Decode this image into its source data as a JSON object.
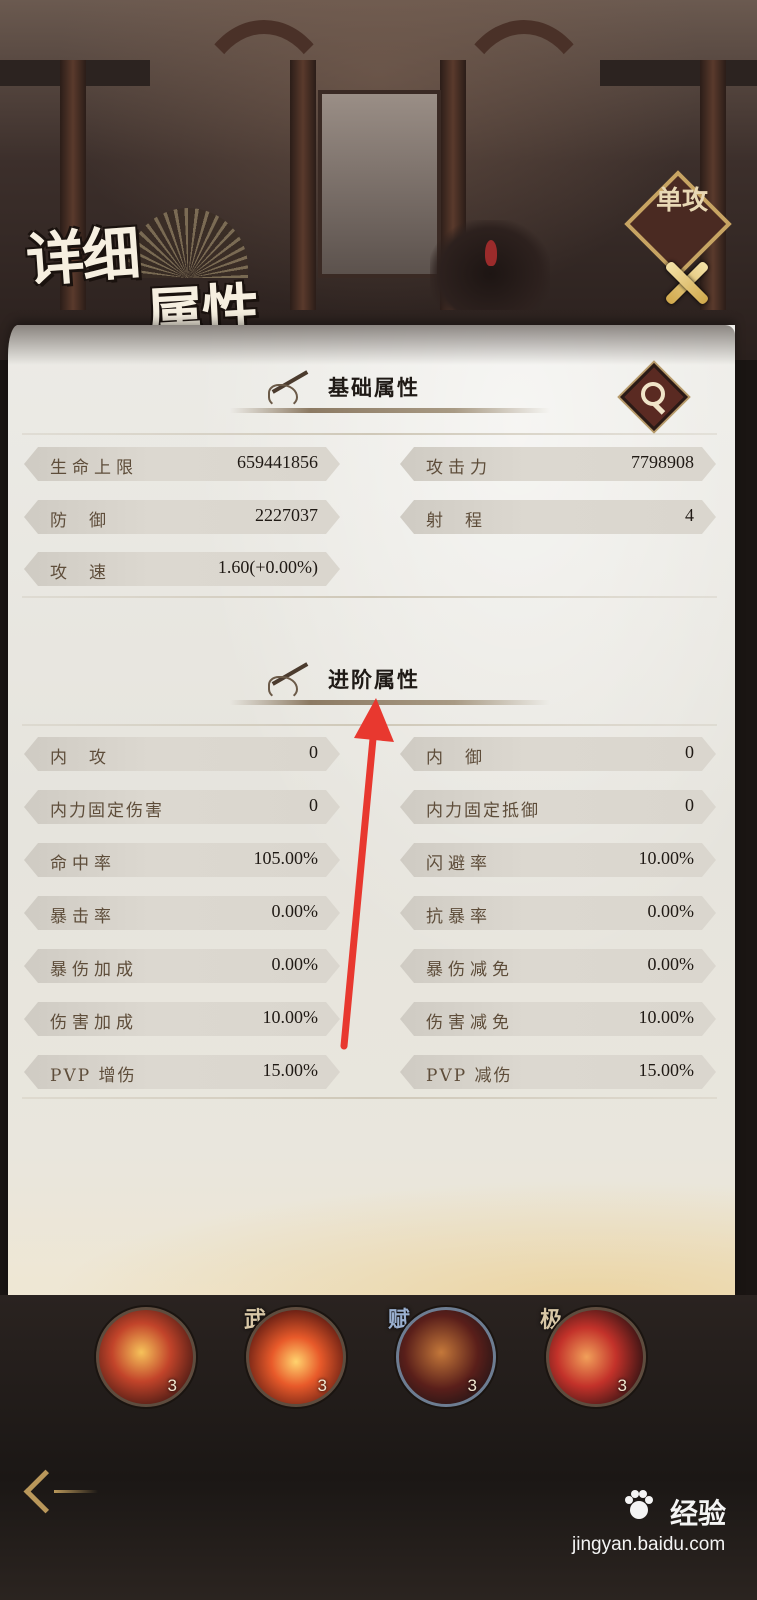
{
  "title": {
    "line1": "详细",
    "line2": "属性"
  },
  "mode_tag": "单攻",
  "sections": {
    "basic": {
      "title": "基础属性"
    },
    "advanced": {
      "title": "进阶属性"
    }
  },
  "basic_stats": [
    {
      "label": "生命上限",
      "value": "659441856"
    },
    {
      "label": "攻击力",
      "value": "7798908"
    },
    {
      "label": "防御",
      "value": "2227037"
    },
    {
      "label": "射程",
      "value": "4"
    },
    {
      "label": "攻速",
      "value": "1.60(+0.00%)"
    }
  ],
  "advanced_stats": [
    {
      "label": "内攻",
      "value": "0"
    },
    {
      "label": "内御",
      "value": "0"
    },
    {
      "label": "内力固定伤害",
      "value": "0"
    },
    {
      "label": "内力固定抵御",
      "value": "0"
    },
    {
      "label": "命中率",
      "value": "105.00%"
    },
    {
      "label": "闪避率",
      "value": "10.00%"
    },
    {
      "label": "暴击率",
      "value": "0.00%"
    },
    {
      "label": "抗暴率",
      "value": "0.00%"
    },
    {
      "label": "暴伤加成",
      "value": "0.00%"
    },
    {
      "label": "暴伤减免",
      "value": "0.00%"
    },
    {
      "label": "伤害加成",
      "value": "10.00%"
    },
    {
      "label": "伤害减免",
      "value": "10.00%"
    },
    {
      "label": "PVP 增伤",
      "value": "15.00%"
    },
    {
      "label": "PVP 减伤",
      "value": "15.00%"
    }
  ],
  "skills": [
    {
      "tag": "",
      "level": "3",
      "icon": "fire-figure-icon"
    },
    {
      "tag": "武",
      "level": "3",
      "icon": "fire-lotus-icon"
    },
    {
      "tag": "赋",
      "level": "3",
      "icon": "feather-blade-icon"
    },
    {
      "tag": "极",
      "level": "3",
      "icon": "crimson-swirl-icon"
    }
  ],
  "watermark": {
    "logo": "Bai du",
    "cn": "经验",
    "url": "jingyan.baidu.com"
  },
  "colors": {
    "panel": "#e6e4dd",
    "stat_bar": "#d8d4cc",
    "label": "#5e4d3a",
    "annotation_arrow": "#e8382f"
  }
}
